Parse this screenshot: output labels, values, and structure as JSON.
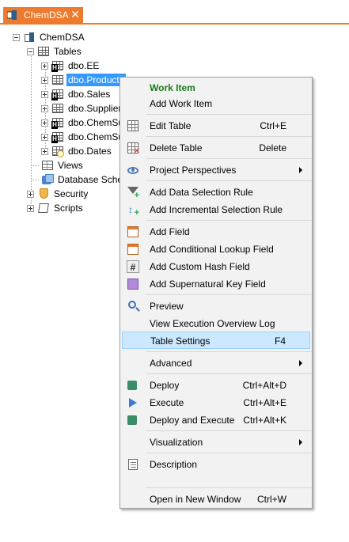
{
  "tab": {
    "title": "ChemDSA",
    "close_glyph": "✕",
    "color": "#ee7a2d"
  },
  "tree": {
    "root": {
      "label": "ChemDSA",
      "icon": "project-icon"
    },
    "tables_folder": {
      "label": "Tables",
      "icon": "tables-folder-icon"
    },
    "tables": [
      {
        "label": "dbo.EE",
        "icon": "table-icon",
        "selected": false
      },
      {
        "label": "dbo.Products",
        "icon": "table-icon",
        "selected": true
      },
      {
        "label": "dbo.Sales",
        "icon": "hub-table-icon",
        "selected": false
      },
      {
        "label": "dbo.Supplier",
        "icon": "table-icon",
        "selected": false
      },
      {
        "label": "dbo.ChemSu",
        "icon": "hub-table-icon",
        "selected": false
      },
      {
        "label": "dbo.ChemSu",
        "icon": "hub-table-icon",
        "selected": false
      },
      {
        "label": "dbo.Dates",
        "icon": "date-table-icon",
        "selected": false
      }
    ],
    "views": {
      "label": "Views",
      "icon": "views-icon"
    },
    "database_schema": {
      "label": "Database Schem",
      "icon": "database-schema-icon"
    },
    "security": {
      "label": "Security",
      "icon": "shield-icon"
    },
    "scripts": {
      "label": "Scripts",
      "icon": "scripts-icon"
    }
  },
  "context_menu": {
    "items": [
      {
        "label": "Work Item",
        "header": true
      },
      {
        "label": "Add Work Item"
      },
      {
        "label": "Edit Table",
        "shortcut": "Ctrl+E",
        "icon": "edit-table-icon"
      },
      {
        "label": "Delete Table",
        "shortcut": "Delete",
        "icon": "delete-table-icon"
      },
      {
        "label": "Project Perspectives",
        "submenu": true,
        "icon": "eye-icon"
      },
      {
        "label": "Add Data Selection Rule",
        "icon": "add-filter-icon"
      },
      {
        "label": "Add Incremental Selection Rule",
        "icon": "incremental-rule-icon"
      },
      {
        "label": "Add Field",
        "icon": "add-field-icon"
      },
      {
        "label": "Add Conditional Lookup Field",
        "icon": "lookup-field-icon"
      },
      {
        "label": "Add Custom Hash Field",
        "icon": "hash-field-icon"
      },
      {
        "label": "Add Supernatural Key Field",
        "icon": "key-field-icon"
      },
      {
        "label": "Preview",
        "icon": "search-icon"
      },
      {
        "label": "View Execution Overview Log"
      },
      {
        "label": "Table Settings",
        "shortcut": "F4",
        "highlighted": true
      },
      {
        "label": "Advanced",
        "submenu": true
      },
      {
        "label": "Deploy",
        "shortcut": "Ctrl+Alt+D",
        "icon": "deploy-icon"
      },
      {
        "label": "Execute",
        "shortcut": "Ctrl+Alt+E",
        "icon": "execute-icon"
      },
      {
        "label": "Deploy and Execute",
        "shortcut": "Ctrl+Alt+K",
        "icon": "deploy-execute-icon"
      },
      {
        "label": "Visualization",
        "submenu": true
      },
      {
        "label": "Description",
        "icon": "description-icon"
      },
      {
        "label": "Open in New Window",
        "shortcut": "Ctrl+W"
      }
    ],
    "highlight_color": "#cce8ff",
    "header_color": "#1b7a1b"
  }
}
